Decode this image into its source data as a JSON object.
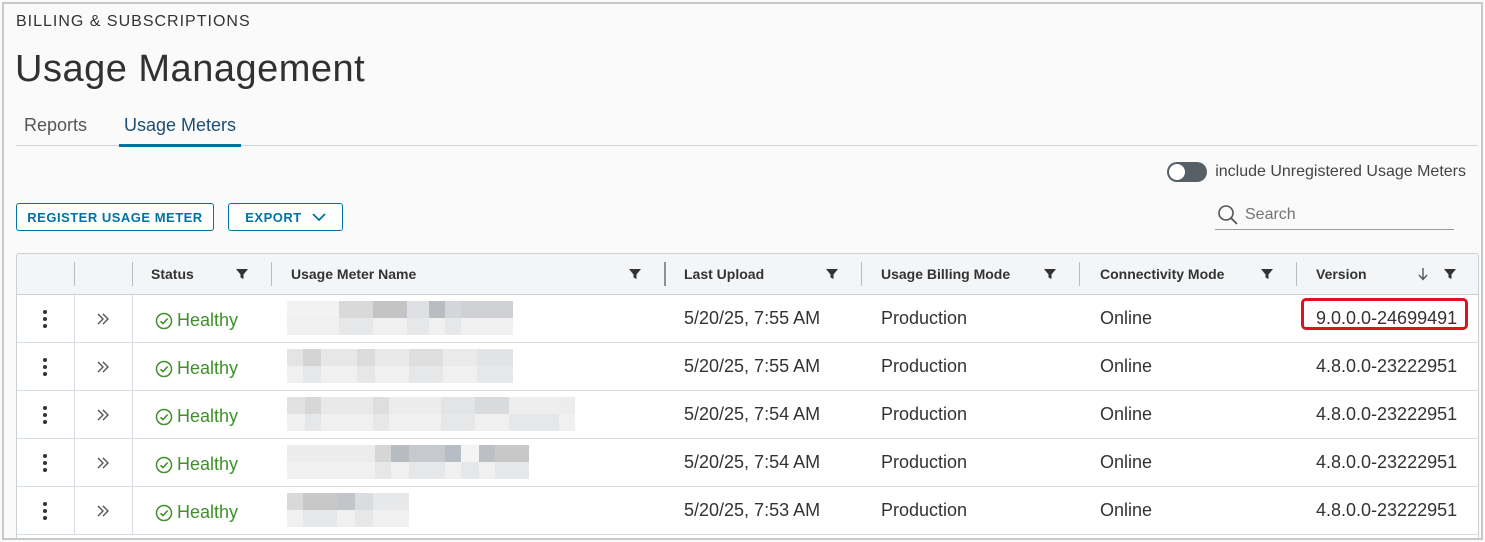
{
  "header": {
    "eyebrow": "BILLING & SUBSCRIPTIONS",
    "title": "Usage Management"
  },
  "tabs": [
    {
      "label": "Reports",
      "active": false
    },
    {
      "label": "Usage Meters",
      "active": true
    }
  ],
  "toolbar": {
    "toggle_label": "include Unregistered Usage Meters",
    "toggle_on": false,
    "register_label": "REGISTER USAGE METER",
    "export_label": "EXPORT",
    "search_placeholder": "Search"
  },
  "table": {
    "columns": {
      "status": "Status",
      "name": "Usage Meter Name",
      "last_upload": "Last Upload",
      "billing_mode": "Usage Billing Mode",
      "connectivity": "Connectivity Mode",
      "version": "Version"
    },
    "version_sort": "descending",
    "rows": [
      {
        "status": "Healthy",
        "last_upload": "5/20/25, 7:55 AM",
        "billing_mode": "Production",
        "connectivity": "Online",
        "version": "9.0.0.0-24699491",
        "highlighted": true
      },
      {
        "status": "Healthy",
        "last_upload": "5/20/25, 7:55 AM",
        "billing_mode": "Production",
        "connectivity": "Online",
        "version": "4.8.0.0-23222951"
      },
      {
        "status": "Healthy",
        "last_upload": "5/20/25, 7:54 AM",
        "billing_mode": "Production",
        "connectivity": "Online",
        "version": "4.8.0.0-23222951"
      },
      {
        "status": "Healthy",
        "last_upload": "5/20/25, 7:54 AM",
        "billing_mode": "Production",
        "connectivity": "Online",
        "version": "4.8.0.0-23222951"
      },
      {
        "status": "Healthy",
        "last_upload": "5/20/25, 7:53 AM",
        "billing_mode": "Production",
        "connectivity": "Online",
        "version": "4.8.0.0-23222951"
      }
    ]
  },
  "colors": {
    "accent": "#0072a3",
    "healthy": "#3f8f2a",
    "highlight": "#d9141e"
  }
}
